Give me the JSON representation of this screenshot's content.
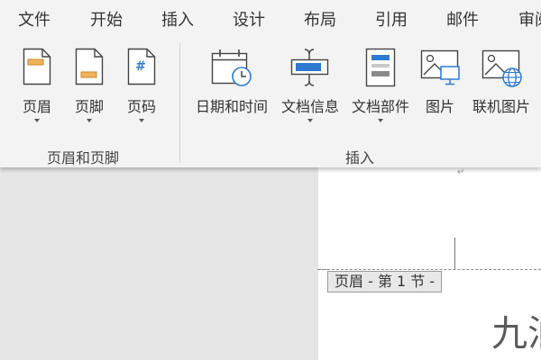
{
  "menu": {
    "tabs": [
      "文件",
      "开始",
      "插入",
      "设计",
      "布局",
      "引用",
      "邮件",
      "审阅"
    ]
  },
  "ribbon": {
    "group1": {
      "label": "页眉和页脚",
      "buttons": {
        "header": {
          "label": "页眉",
          "icon": "header-page-icon"
        },
        "footer": {
          "label": "页脚",
          "icon": "footer-page-icon"
        },
        "page_number": {
          "label": "页码",
          "icon": "page-number-icon",
          "glyph": "#"
        }
      }
    },
    "group2": {
      "label": "插入",
      "buttons": {
        "date_time": {
          "label": "日期和时间",
          "icon": "calendar-clock-icon"
        },
        "doc_info": {
          "label": "文档信息",
          "icon": "document-info-icon"
        },
        "doc_parts": {
          "label": "文档部件",
          "icon": "document-parts-icon"
        },
        "picture": {
          "label": "图片",
          "icon": "picture-icon"
        },
        "online_picture": {
          "label": "联机图片",
          "icon": "online-picture-icon"
        }
      }
    }
  },
  "document": {
    "pilcrow": "↵",
    "header_tag": "页眉 - 第 1 节 -",
    "body_text": "九泊"
  },
  "colors": {
    "accent_orange": "#f2b25c",
    "accent_blue": "#2e7ad1",
    "ribbon_bg": "#f3f3f3",
    "workspace_bg": "#e6e6e6"
  }
}
